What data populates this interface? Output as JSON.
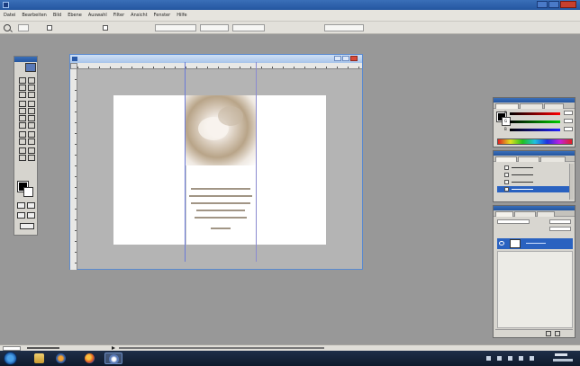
{
  "window": {
    "title": "",
    "controls": [
      "minimize-button",
      "maximize-button",
      "close-button"
    ]
  },
  "menu": {
    "items": [
      "Datei",
      "Bearbeiten",
      "Bild",
      "Ebene",
      "Auswahl",
      "Filter",
      "Ansicht",
      "Fenster",
      "Hilfe"
    ]
  },
  "options_bar": {
    "tool_icon": "zoom-icon",
    "fields": [
      {
        "label": "",
        "type": "checkbox"
      },
      {
        "label": "",
        "type": "checkbox"
      },
      {
        "label": "",
        "type": "button"
      },
      {
        "label": "",
        "type": "button"
      },
      {
        "label": "",
        "type": "button"
      }
    ],
    "palette_well": ""
  },
  "document": {
    "title": "",
    "page": {
      "color": "#ffffff",
      "guides": 2,
      "folds": 3,
      "verse_lines": 6
    }
  },
  "panels": {
    "color": {
      "tabs": [
        "",
        "",
        ""
      ],
      "channels": [
        {
          "name": "R",
          "value": ""
        },
        {
          "name": "G",
          "value": ""
        },
        {
          "name": "B",
          "value": ""
        }
      ]
    },
    "history": {
      "tabs": [
        "",
        "",
        ""
      ],
      "steps": [
        "",
        "",
        "",
        ""
      ],
      "active_step": 3
    },
    "layers": {
      "tabs": [
        "",
        "",
        ""
      ],
      "blend_mode": "",
      "opacity": "",
      "layer_name": ""
    }
  },
  "statusbar": {
    "zoom": "",
    "doc_info": "",
    "hint": ""
  },
  "taskbar": {
    "start": "windows-start-icon",
    "apps": [
      "file-explorer-icon",
      "media-player-icon",
      "firefox-icon",
      "photoshop-icon"
    ],
    "clock_time": "",
    "clock_date": ""
  },
  "colors": {
    "accent": "#2a62c0",
    "workspace": "#989898",
    "guide": "#6a7ad8"
  }
}
